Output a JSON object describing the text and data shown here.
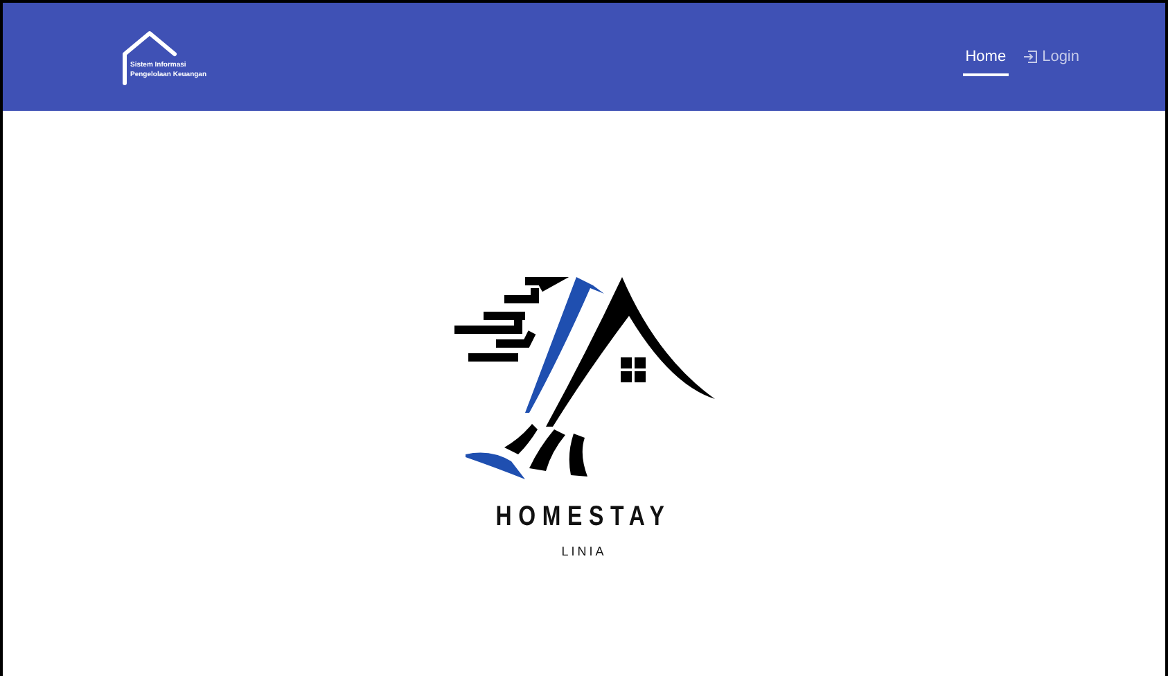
{
  "brand": {
    "lines": [
      "Sistem Informasi",
      "Pengelolaan Keuangan"
    ]
  },
  "nav": [
    {
      "label": "Home",
      "kind": "link",
      "selected": true
    },
    {
      "label": "Login",
      "kind": "login",
      "selected": false
    }
  ],
  "hero": {
    "title": "HOMESTAY",
    "subtitle": "LINIA"
  }
}
